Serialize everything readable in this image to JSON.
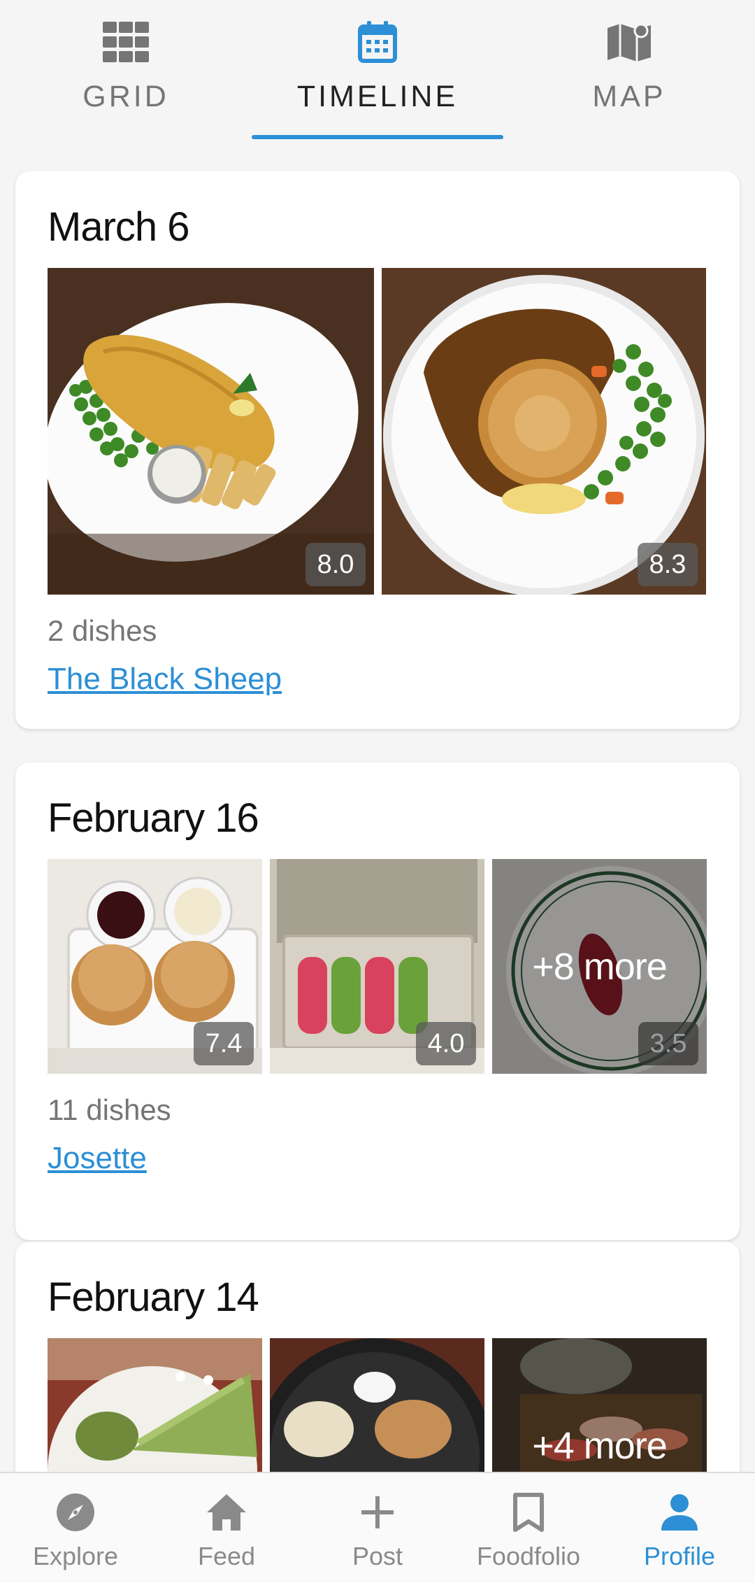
{
  "view_tabs": [
    {
      "label": "GRID",
      "icon": "grid-icon",
      "active": false
    },
    {
      "label": "TIMELINE",
      "icon": "calendar-icon",
      "active": true
    },
    {
      "label": "MAP",
      "icon": "map-icon",
      "active": false
    }
  ],
  "accent_color": "#2d8fd5",
  "cards": [
    {
      "date": "March 6",
      "photos": [
        {
          "rating": "8.0",
          "description": "fish-and-chips"
        },
        {
          "rating": "8.3",
          "description": "meat-pie"
        }
      ],
      "count": "2 dishes",
      "place": "The Black Sheep"
    },
    {
      "date": "February 16",
      "photos": [
        {
          "rating": "7.4",
          "description": "scones"
        },
        {
          "rating": "4.0",
          "description": "macarons"
        },
        {
          "rating": "3.5",
          "description": "tuna-plate",
          "more": "+8 more"
        }
      ],
      "count": "11 dishes",
      "place": "Josette"
    },
    {
      "date": "February 14",
      "photos": [
        {
          "description": "matcha-cake"
        },
        {
          "description": "dessert-pan"
        },
        {
          "description": "sushi",
          "more": "+4 more"
        }
      ]
    }
  ],
  "bottom_nav": [
    {
      "label": "Explore",
      "icon": "compass-icon",
      "active": false
    },
    {
      "label": "Feed",
      "icon": "home-icon",
      "active": false
    },
    {
      "label": "Post",
      "icon": "plus-icon",
      "active": false
    },
    {
      "label": "Foodfolio",
      "icon": "bookmark-icon",
      "active": false
    },
    {
      "label": "Profile",
      "icon": "person-icon",
      "active": true
    }
  ]
}
